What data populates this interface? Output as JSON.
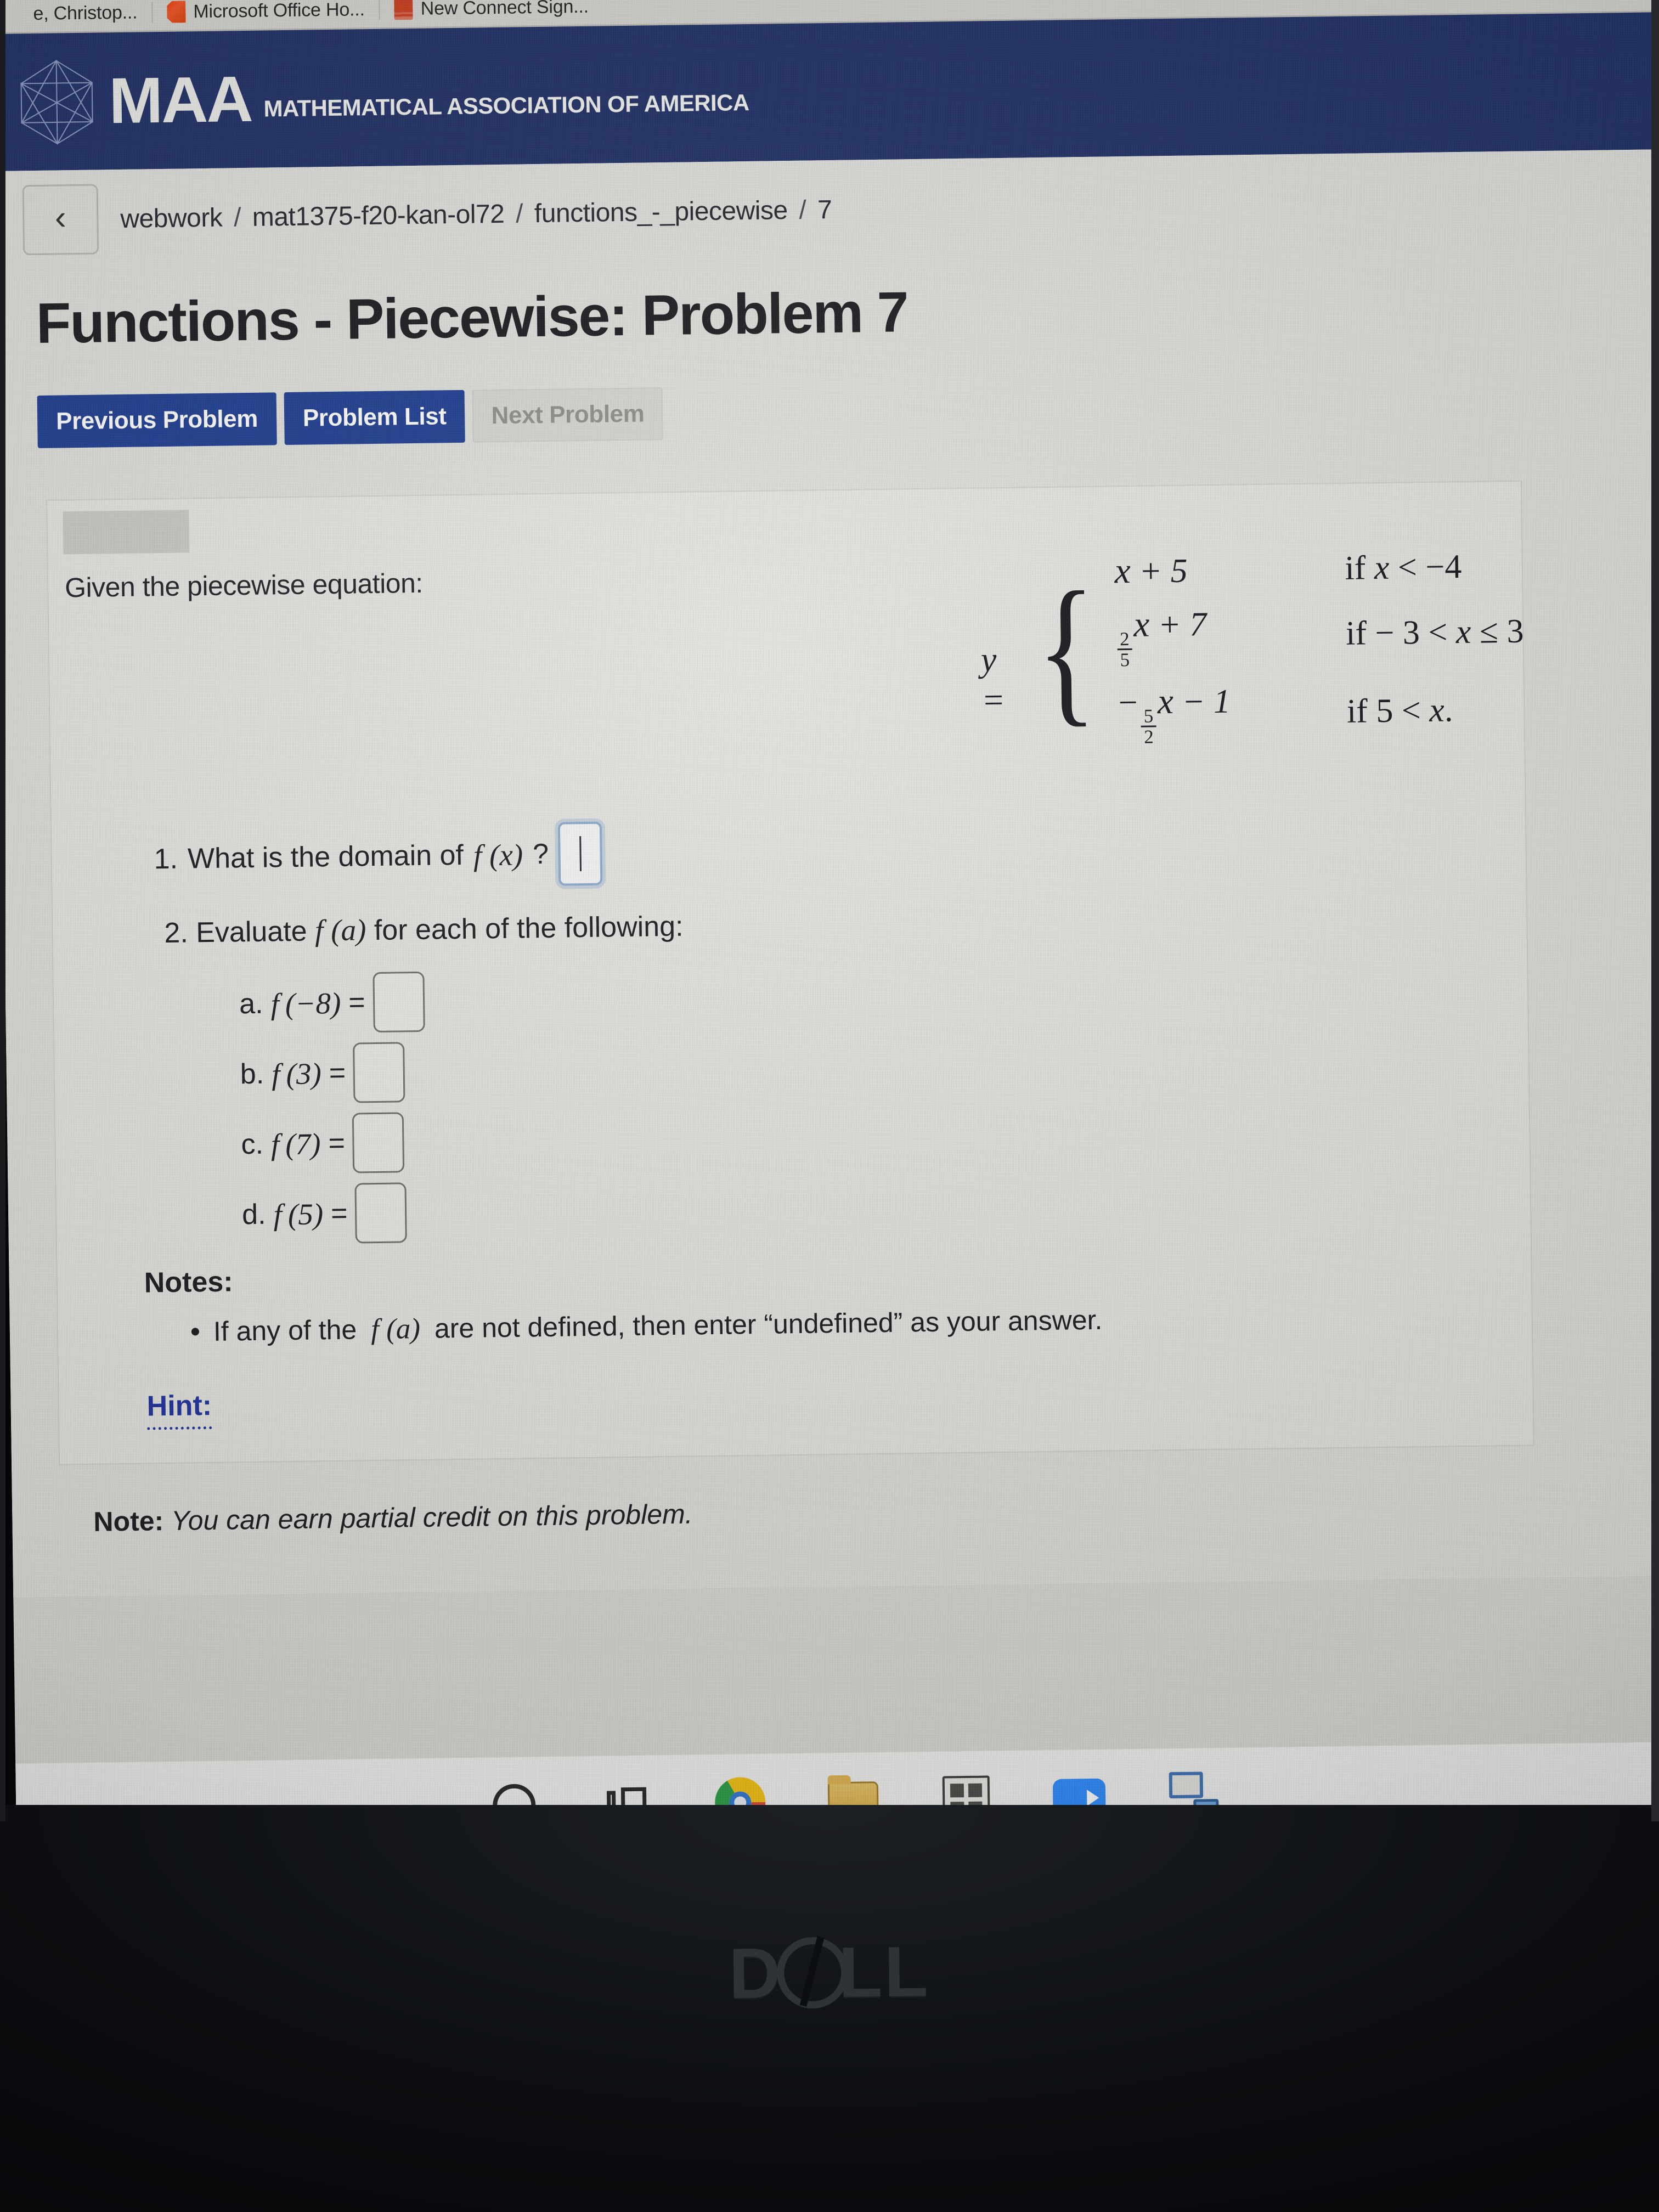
{
  "browser": {
    "tabs": [
      {
        "title": "e, Christop...",
        "favicon": "generic-favicon"
      },
      {
        "title": "Microsoft Office Ho...",
        "favicon": "office-icon"
      },
      {
        "title": "New Connect Sign...",
        "favicon": "red-doc-icon"
      }
    ]
  },
  "site_header": {
    "logo_text": "MAA",
    "logo_subtitle": "MATHEMATICAL ASSOCIATION OF AMERICA",
    "logo_icon": "icosahedron-icon",
    "banner_color": "#1c2c63"
  },
  "breadcrumb": {
    "back_icon": "chevron-left-icon",
    "items": [
      "webwork",
      "mat1375-f20-kan-ol72",
      "functions_-_piecewise",
      "7"
    ],
    "separator": "/"
  },
  "page": {
    "title": "Functions - Piecewise: Problem 7"
  },
  "nav_buttons": [
    {
      "label": "Previous Problem",
      "state": "enabled"
    },
    {
      "label": "Problem List",
      "state": "enabled"
    },
    {
      "label": "Next Problem",
      "state": "disabled"
    }
  ],
  "problem": {
    "given_text": "Given the piecewise equation:",
    "equation": {
      "lhs": "y =",
      "rows": [
        {
          "expr_plain": "x + 5",
          "expr_var": "x",
          "expr_rest": "+ 5",
          "cond_prefix": "if ",
          "cond": "x < −4"
        },
        {
          "expr_plain": "(2/5)x + 7",
          "frac_num": "2",
          "frac_den": "5",
          "expr_var": "x",
          "expr_rest": "+ 7",
          "cond_prefix": "if ",
          "cond": "− 3 < x ≤ 3"
        },
        {
          "expr_plain": "−(5/2)x − 1",
          "sign": "−",
          "frac_num": "5",
          "frac_den": "2",
          "expr_var": "x",
          "expr_rest": "− 1",
          "cond_prefix": "if ",
          "cond": "5 < x."
        }
      ]
    },
    "questions": [
      {
        "number": "1.",
        "text_before": "What is the domain of",
        "math": "f (x)",
        "text_after": "?",
        "input_value": "",
        "input_focused": true
      },
      {
        "number": "2.",
        "text_before": "Evaluate",
        "math": "f (a)",
        "text_after": "for each of the following:"
      }
    ],
    "sub_questions": [
      {
        "label": "a.",
        "math_f": "f",
        "math_arg": "(−8)",
        "equals": "=",
        "value": ""
      },
      {
        "label": "b.",
        "math_f": "f",
        "math_arg": "(3)",
        "equals": "=",
        "value": ""
      },
      {
        "label": "c.",
        "math_f": "f",
        "math_arg": "(7)",
        "equals": "=",
        "value": ""
      },
      {
        "label": "d.",
        "math_f": "f",
        "math_arg": "(5)",
        "equals": "=",
        "value": ""
      }
    ],
    "notes": {
      "heading": "Notes:",
      "items": [
        {
          "text_before": "If any of the",
          "math": "f (a)",
          "text_after": "are not defined, then enter “undefined” as your answer."
        }
      ]
    },
    "hint_label": "Hint:",
    "hint_color": "#1b2f9e"
  },
  "footer_note": {
    "bold": "Note:",
    "italic": "You can earn partial credit on this problem."
  },
  "taskbar": {
    "items": [
      {
        "name": "cortana-search-icon",
        "label": "Search",
        "active": false
      },
      {
        "name": "task-view-icon",
        "label": "Task View",
        "active": false
      },
      {
        "name": "chrome-icon",
        "label": "Google Chrome",
        "active": true
      },
      {
        "name": "file-explorer-icon",
        "label": "File Explorer",
        "active": false
      },
      {
        "name": "microsoft-store-icon",
        "label": "Microsoft Store",
        "active": false
      },
      {
        "name": "zoom-icon",
        "label": "Zoom",
        "active": false
      },
      {
        "name": "remote-desktop-icon",
        "label": "Remote Desktop",
        "active": false
      }
    ]
  },
  "device": {
    "brand": "DELL"
  }
}
